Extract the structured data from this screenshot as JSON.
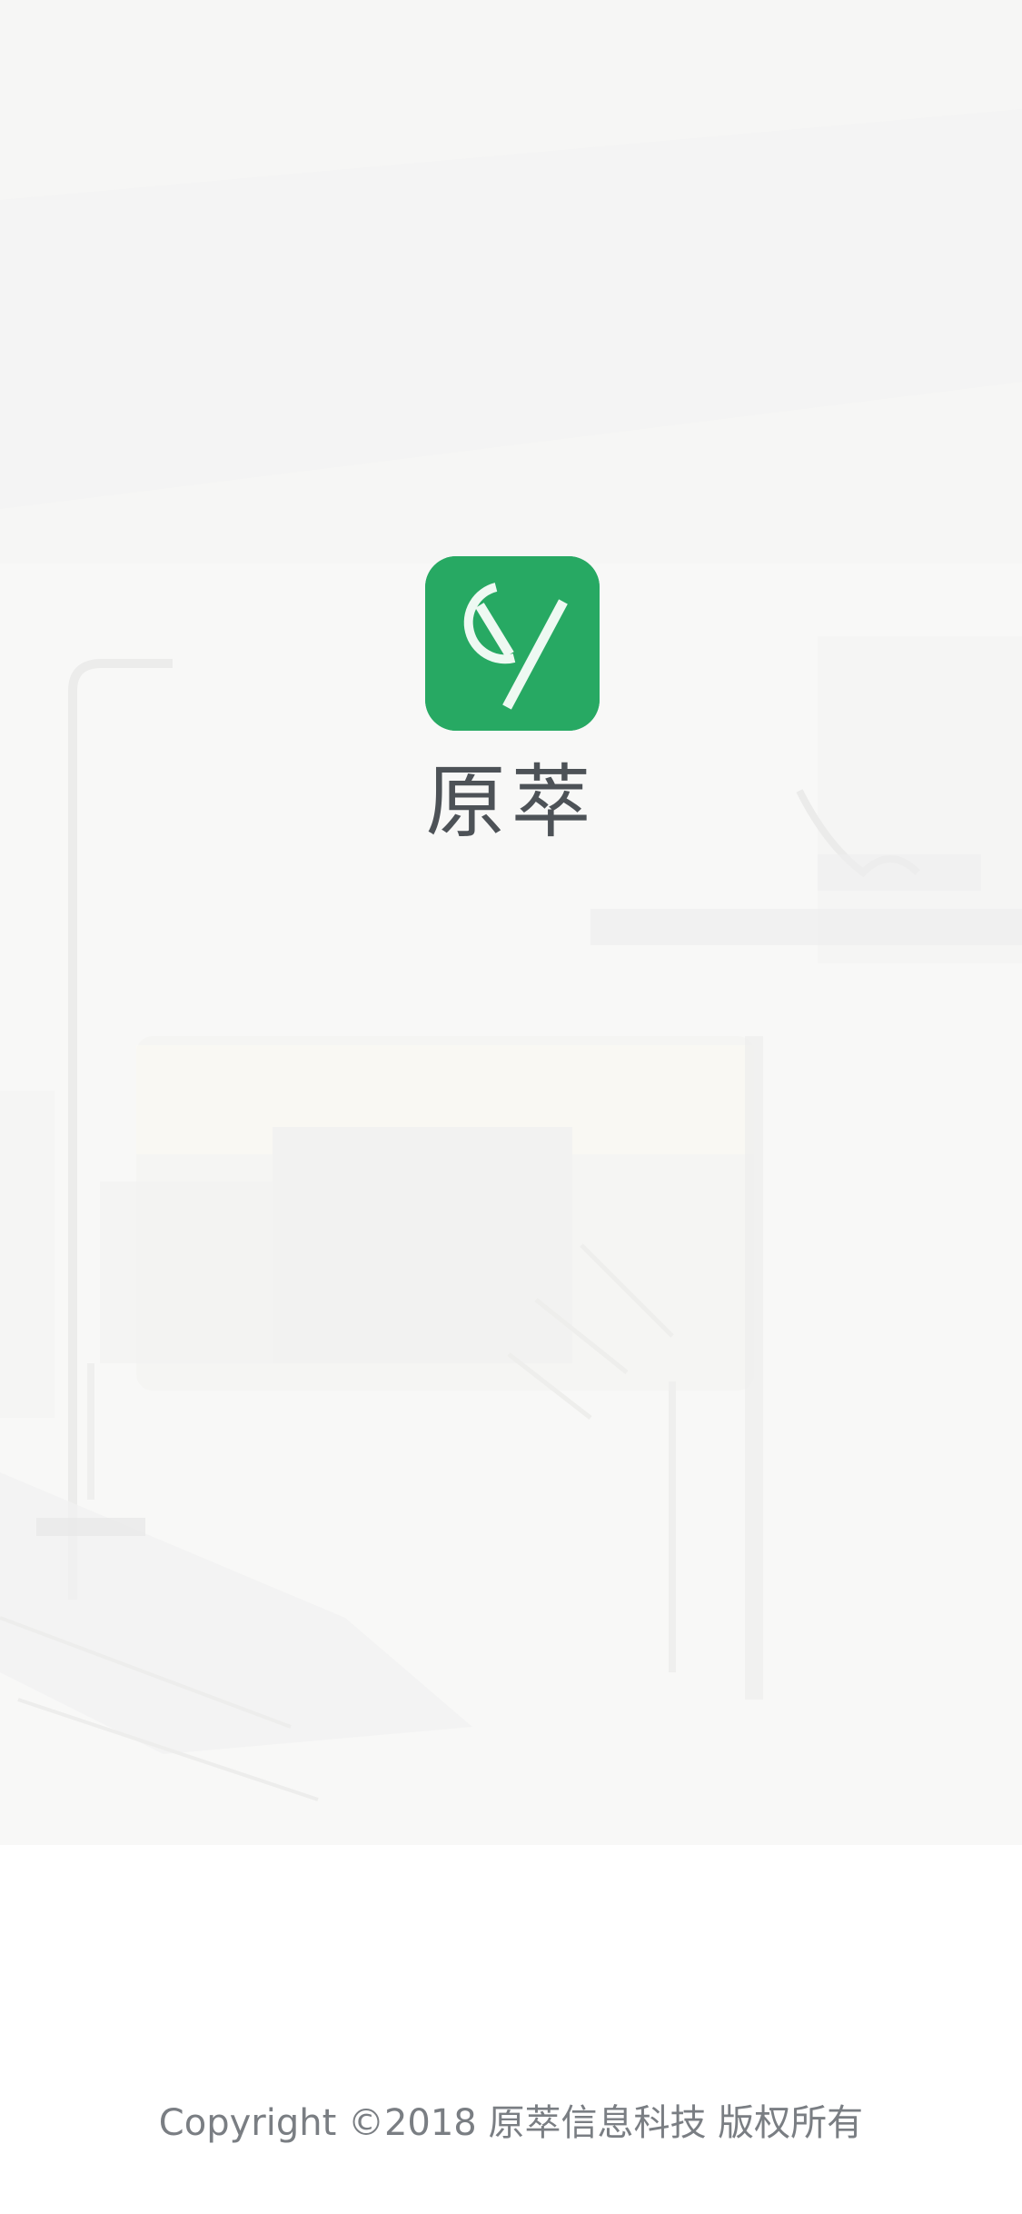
{
  "splash": {
    "app_name": "原萃",
    "logo_icon": "cy-logo-icon",
    "background_image": "faded-living-room-photo",
    "copyright": "Copyright ©2018 原萃信息科技 版权所有"
  },
  "colors": {
    "brand_green": "#27a963",
    "title_text": "#4d5257",
    "footer_text": "#7a7e83",
    "background": "#ffffff"
  }
}
